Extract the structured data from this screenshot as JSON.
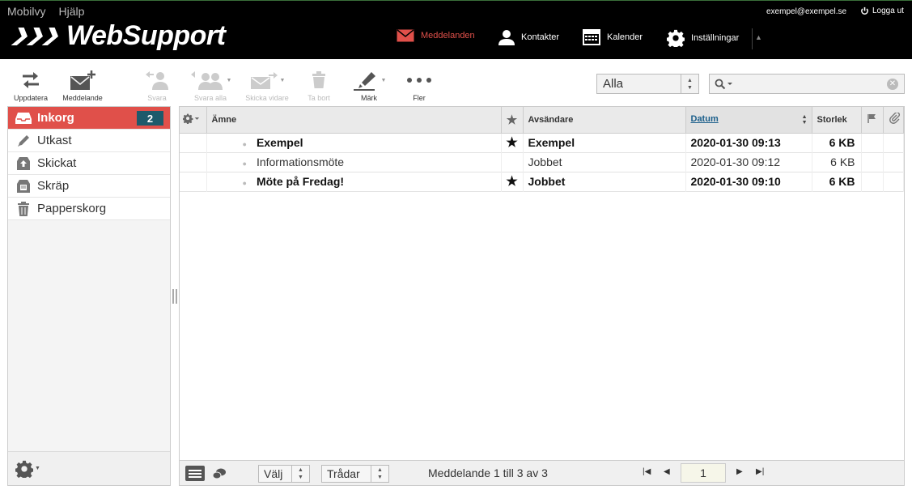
{
  "header": {
    "links": [
      "Mobilvy",
      "Hjälp"
    ],
    "logo_text": "WebSupport",
    "user_email": "exempel@exempel.se",
    "logout_label": "Logga ut",
    "nav": [
      {
        "label": "Meddelanden",
        "icon": "envelope-icon",
        "active": true
      },
      {
        "label": "Kontakter",
        "icon": "person-icon"
      },
      {
        "label": "Kalender",
        "icon": "calendar-icon"
      },
      {
        "label": "Inställningar",
        "icon": "gear-icon"
      }
    ]
  },
  "toolbar": {
    "buttons": [
      {
        "label": "Uppdatera",
        "enabled": true
      },
      {
        "label": "Meddelande",
        "enabled": true
      },
      {
        "label": "Svara",
        "enabled": false
      },
      {
        "label": "Svara alla",
        "enabled": false
      },
      {
        "label": "Skicka vidare",
        "enabled": false
      },
      {
        "label": "Ta bort",
        "enabled": false
      },
      {
        "label": "Märk",
        "enabled": true
      },
      {
        "label": "Fler",
        "enabled": true
      }
    ],
    "filter_value": "Alla",
    "search_value": ""
  },
  "sidebar": {
    "folders": [
      {
        "label": "Inkorg",
        "count": "2",
        "active": true
      },
      {
        "label": "Utkast"
      },
      {
        "label": "Skickat"
      },
      {
        "label": "Skräp"
      },
      {
        "label": "Papperskorg"
      }
    ]
  },
  "list": {
    "columns": {
      "subject": "Ämne",
      "sender": "Avsändare",
      "date": "Datum",
      "size": "Storlek"
    },
    "rows": [
      {
        "subject": "Exempel",
        "sender": "Exempel",
        "date": "2020-01-30 09:13",
        "size": "6 KB",
        "unread": true,
        "flagged": true
      },
      {
        "subject": "Informationsmöte",
        "sender": "Jobbet",
        "date": "2020-01-30 09:12",
        "size": "6 KB",
        "unread": false,
        "flagged": false
      },
      {
        "subject": "Möte på Fredag!",
        "sender": "Jobbet",
        "date": "2020-01-30 09:10",
        "size": "6 KB",
        "unread": true,
        "flagged": true
      }
    ],
    "footer": {
      "select_label": "Välj",
      "threads_label": "Trådar",
      "pager_text": "Meddelande 1 till 3 av 3",
      "page": "1"
    }
  },
  "colors": {
    "accent": "#e0504a",
    "badge": "#1e5a6b",
    "header_bg": "#000000"
  }
}
